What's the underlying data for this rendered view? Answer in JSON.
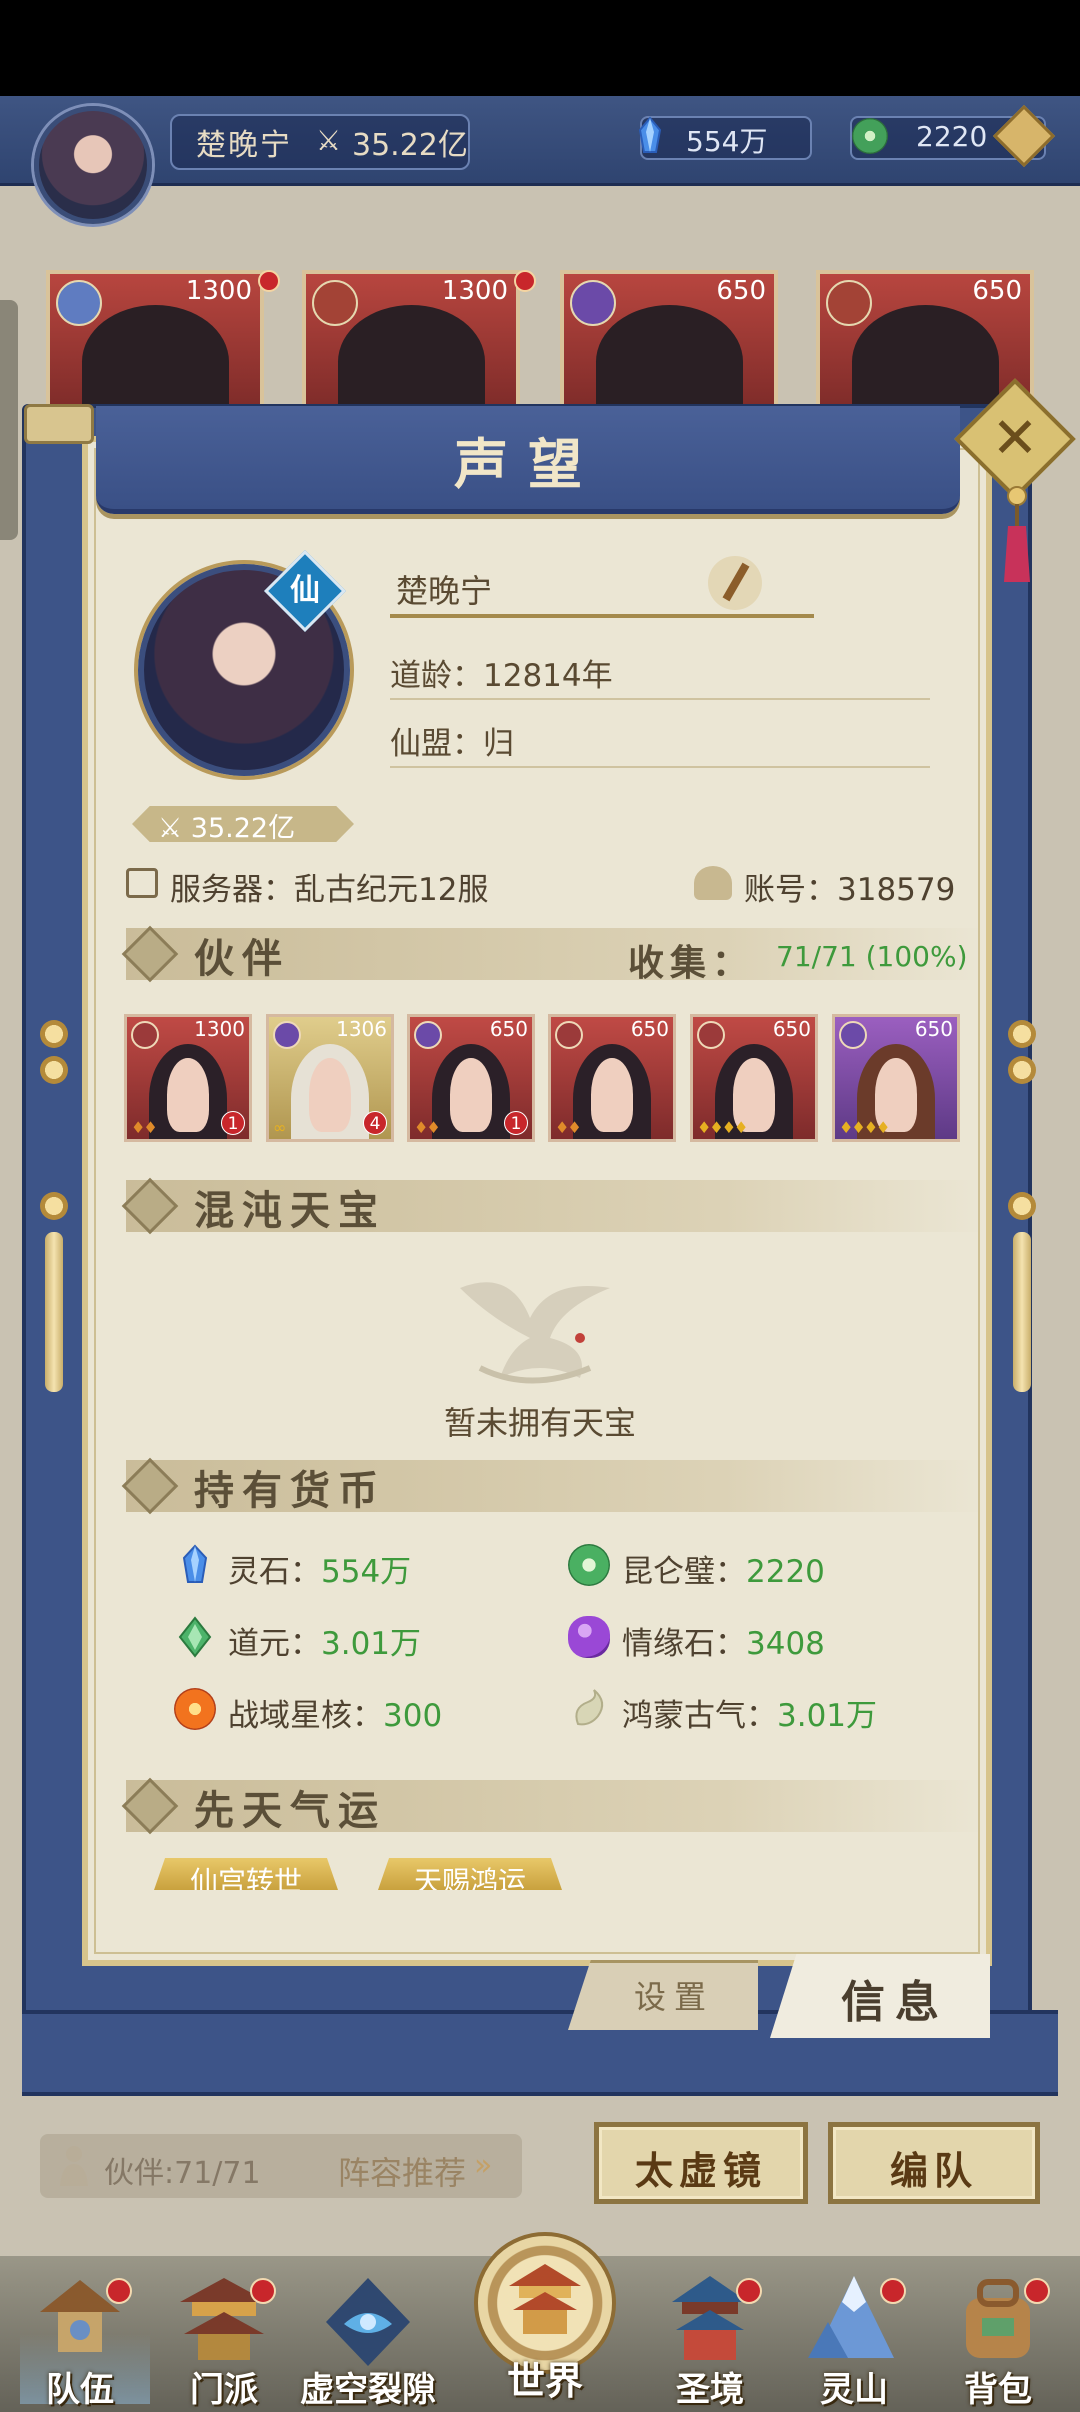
{
  "header": {
    "player_name": "楚晚宁",
    "power": "35.22亿",
    "spirit_stone": "554万",
    "jade": "2220",
    "plus_icon": "plus-icon"
  },
  "bg_heroes": [
    {
      "level": "1300"
    },
    {
      "level": "1300"
    },
    {
      "level": "650"
    },
    {
      "level": "650"
    }
  ],
  "modal": {
    "title": "声望",
    "close_icon": "close-icon",
    "profile": {
      "name": "楚晚宁",
      "badge": "仙",
      "daoling": "道龄：12814年",
      "guild": "仙盟：归",
      "power": "35.22亿",
      "server": "服务器：乱古纪元12服",
      "account": "账号：318579"
    },
    "partners": {
      "title": "伙伴",
      "collect_label": "收集：",
      "collect_value": "71/71 (100%)",
      "cards": [
        {
          "level": "1300",
          "stars": "♦♦",
          "badge": "1"
        },
        {
          "level": "1306",
          "stars": "∞",
          "badge": "4"
        },
        {
          "level": "650",
          "stars": "♦♦",
          "badge": "1"
        },
        {
          "level": "650",
          "stars": "♦♦",
          "badge": ""
        },
        {
          "level": "650",
          "stars": "♦♦♦♦",
          "badge": ""
        },
        {
          "level": "650",
          "stars": "♦♦♦♦",
          "badge": ""
        }
      ]
    },
    "treasure": {
      "title": "混沌天宝",
      "empty_text": "暂未拥有天宝"
    },
    "currency": {
      "title": "持有货币",
      "items": [
        {
          "name": "灵石：",
          "value": "554万",
          "icon": "spirit-stone-icon",
          "color": "#3b6fd4"
        },
        {
          "name": "昆仑璧：",
          "value": "2220",
          "icon": "kunlun-jade-icon",
          "color": "#3ea35a"
        },
        {
          "name": "道元：",
          "value": "3.01万",
          "icon": "daoyuan-icon",
          "color": "#4db36a"
        },
        {
          "name": "情缘石：",
          "value": "3408",
          "icon": "love-stone-icon",
          "color": "#8f3fc8"
        },
        {
          "name": "战域星核：",
          "value": "300",
          "icon": "star-core-icon",
          "color": "#e0561f"
        },
        {
          "name": "鸿蒙古气：",
          "value": "3.01万",
          "icon": "ancient-qi-icon",
          "color": "#c9c7a4"
        }
      ]
    },
    "fortune": {
      "title": "先天气运",
      "items": [
        "仙宫转世",
        "天赐鸿运"
      ]
    },
    "tabs": {
      "settings": "设置",
      "info": "信息"
    }
  },
  "bottom": {
    "partner_count": "伙伴:71/71",
    "lineup_recommend": "阵容推荐",
    "taixu_button": "太虚镜",
    "team_button": "编队"
  },
  "nav": [
    {
      "label": "队伍",
      "icon": "team-icon"
    },
    {
      "label": "门派",
      "icon": "sect-icon"
    },
    {
      "label": "虚空裂隙",
      "icon": "void-rift-icon"
    },
    {
      "label": "世界",
      "icon": "world-icon"
    },
    {
      "label": "圣境",
      "icon": "holy-realm-icon"
    },
    {
      "label": "灵山",
      "icon": "spirit-mountain-icon"
    },
    {
      "label": "背包",
      "icon": "backpack-icon"
    }
  ]
}
